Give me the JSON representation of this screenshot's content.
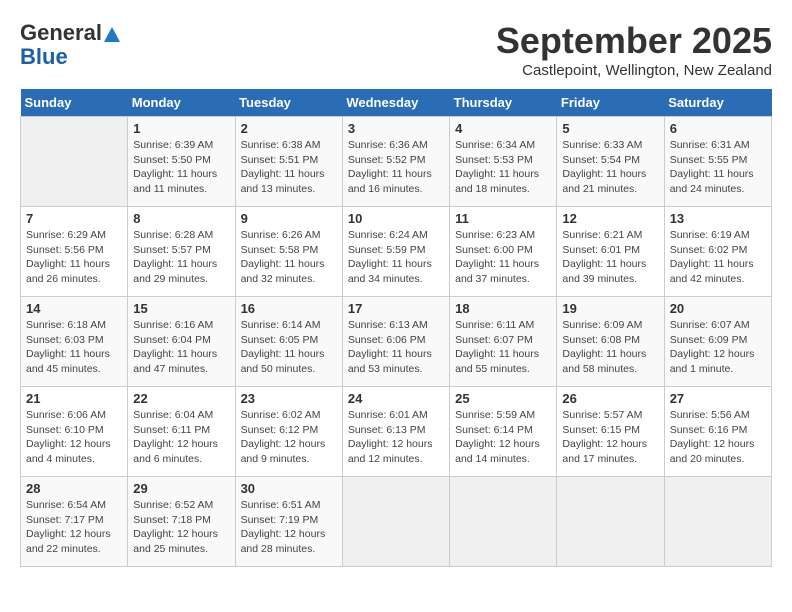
{
  "header": {
    "logo_general": "General",
    "logo_blue": "Blue",
    "month_title": "September 2025",
    "location": "Castlepoint, Wellington, New Zealand"
  },
  "calendar": {
    "days_of_week": [
      "Sunday",
      "Monday",
      "Tuesday",
      "Wednesday",
      "Thursday",
      "Friday",
      "Saturday"
    ],
    "weeks": [
      [
        {
          "day": "",
          "info": ""
        },
        {
          "day": "1",
          "info": "Sunrise: 6:39 AM\nSunset: 5:50 PM\nDaylight: 11 hours\nand 11 minutes."
        },
        {
          "day": "2",
          "info": "Sunrise: 6:38 AM\nSunset: 5:51 PM\nDaylight: 11 hours\nand 13 minutes."
        },
        {
          "day": "3",
          "info": "Sunrise: 6:36 AM\nSunset: 5:52 PM\nDaylight: 11 hours\nand 16 minutes."
        },
        {
          "day": "4",
          "info": "Sunrise: 6:34 AM\nSunset: 5:53 PM\nDaylight: 11 hours\nand 18 minutes."
        },
        {
          "day": "5",
          "info": "Sunrise: 6:33 AM\nSunset: 5:54 PM\nDaylight: 11 hours\nand 21 minutes."
        },
        {
          "day": "6",
          "info": "Sunrise: 6:31 AM\nSunset: 5:55 PM\nDaylight: 11 hours\nand 24 minutes."
        }
      ],
      [
        {
          "day": "7",
          "info": "Sunrise: 6:29 AM\nSunset: 5:56 PM\nDaylight: 11 hours\nand 26 minutes."
        },
        {
          "day": "8",
          "info": "Sunrise: 6:28 AM\nSunset: 5:57 PM\nDaylight: 11 hours\nand 29 minutes."
        },
        {
          "day": "9",
          "info": "Sunrise: 6:26 AM\nSunset: 5:58 PM\nDaylight: 11 hours\nand 32 minutes."
        },
        {
          "day": "10",
          "info": "Sunrise: 6:24 AM\nSunset: 5:59 PM\nDaylight: 11 hours\nand 34 minutes."
        },
        {
          "day": "11",
          "info": "Sunrise: 6:23 AM\nSunset: 6:00 PM\nDaylight: 11 hours\nand 37 minutes."
        },
        {
          "day": "12",
          "info": "Sunrise: 6:21 AM\nSunset: 6:01 PM\nDaylight: 11 hours\nand 39 minutes."
        },
        {
          "day": "13",
          "info": "Sunrise: 6:19 AM\nSunset: 6:02 PM\nDaylight: 11 hours\nand 42 minutes."
        }
      ],
      [
        {
          "day": "14",
          "info": "Sunrise: 6:18 AM\nSunset: 6:03 PM\nDaylight: 11 hours\nand 45 minutes."
        },
        {
          "day": "15",
          "info": "Sunrise: 6:16 AM\nSunset: 6:04 PM\nDaylight: 11 hours\nand 47 minutes."
        },
        {
          "day": "16",
          "info": "Sunrise: 6:14 AM\nSunset: 6:05 PM\nDaylight: 11 hours\nand 50 minutes."
        },
        {
          "day": "17",
          "info": "Sunrise: 6:13 AM\nSunset: 6:06 PM\nDaylight: 11 hours\nand 53 minutes."
        },
        {
          "day": "18",
          "info": "Sunrise: 6:11 AM\nSunset: 6:07 PM\nDaylight: 11 hours\nand 55 minutes."
        },
        {
          "day": "19",
          "info": "Sunrise: 6:09 AM\nSunset: 6:08 PM\nDaylight: 11 hours\nand 58 minutes."
        },
        {
          "day": "20",
          "info": "Sunrise: 6:07 AM\nSunset: 6:09 PM\nDaylight: 12 hours\nand 1 minute."
        }
      ],
      [
        {
          "day": "21",
          "info": "Sunrise: 6:06 AM\nSunset: 6:10 PM\nDaylight: 12 hours\nand 4 minutes."
        },
        {
          "day": "22",
          "info": "Sunrise: 6:04 AM\nSunset: 6:11 PM\nDaylight: 12 hours\nand 6 minutes."
        },
        {
          "day": "23",
          "info": "Sunrise: 6:02 AM\nSunset: 6:12 PM\nDaylight: 12 hours\nand 9 minutes."
        },
        {
          "day": "24",
          "info": "Sunrise: 6:01 AM\nSunset: 6:13 PM\nDaylight: 12 hours\nand 12 minutes."
        },
        {
          "day": "25",
          "info": "Sunrise: 5:59 AM\nSunset: 6:14 PM\nDaylight: 12 hours\nand 14 minutes."
        },
        {
          "day": "26",
          "info": "Sunrise: 5:57 AM\nSunset: 6:15 PM\nDaylight: 12 hours\nand 17 minutes."
        },
        {
          "day": "27",
          "info": "Sunrise: 5:56 AM\nSunset: 6:16 PM\nDaylight: 12 hours\nand 20 minutes."
        }
      ],
      [
        {
          "day": "28",
          "info": "Sunrise: 6:54 AM\nSunset: 7:17 PM\nDaylight: 12 hours\nand 22 minutes."
        },
        {
          "day": "29",
          "info": "Sunrise: 6:52 AM\nSunset: 7:18 PM\nDaylight: 12 hours\nand 25 minutes."
        },
        {
          "day": "30",
          "info": "Sunrise: 6:51 AM\nSunset: 7:19 PM\nDaylight: 12 hours\nand 28 minutes."
        },
        {
          "day": "",
          "info": ""
        },
        {
          "day": "",
          "info": ""
        },
        {
          "day": "",
          "info": ""
        },
        {
          "day": "",
          "info": ""
        }
      ]
    ]
  }
}
